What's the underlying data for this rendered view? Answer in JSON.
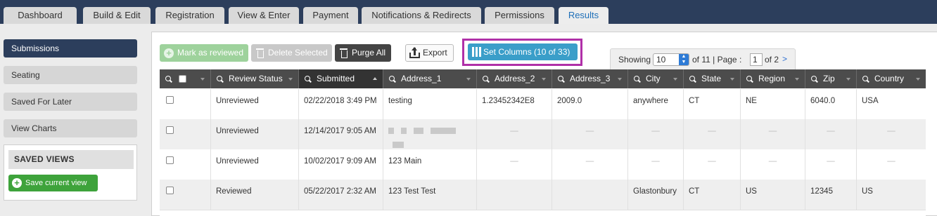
{
  "tabs": [
    {
      "label": "Dashboard"
    },
    {
      "label": "Build & Edit"
    },
    {
      "label": "Registration"
    },
    {
      "label": "View & Enter"
    },
    {
      "label": "Payment"
    },
    {
      "label": "Notifications & Redirects"
    },
    {
      "label": "Permissions"
    },
    {
      "label": "Results",
      "active": true
    }
  ],
  "sidebar": {
    "items": [
      {
        "label": "Submissions",
        "active": true
      },
      {
        "label": "Seating"
      },
      {
        "label": "Saved For Later"
      },
      {
        "label": "View Charts"
      }
    ],
    "saved_views": {
      "title": "SAVED VIEWS",
      "save_button": "Save current view"
    }
  },
  "toolbar": {
    "mark_reviewed": "Mark as reviewed",
    "delete_selected": "Delete Selected",
    "purge_all": "Purge All",
    "export": "Export",
    "set_columns": "Set Columns (10 of 33)"
  },
  "pager": {
    "showing_label": "Showing",
    "per_page": "10",
    "of_total": "of 11 | Page :",
    "page": "1",
    "of_pages": "of 2",
    "next": ">"
  },
  "table": {
    "columns": [
      "Review Status",
      "Submitted",
      "Address_1",
      "Address_2",
      "Address_3",
      "City",
      "State",
      "Region",
      "Zip",
      "Country"
    ],
    "sorted_column": "Submitted",
    "rows": [
      {
        "review_status": "Unreviewed",
        "submitted": "02/22/2018 3:49 PM",
        "address_1": "testing",
        "address_2": "1.23452342E8",
        "address_3": "2009.0",
        "city": "anywhere",
        "state": "CT",
        "region": "NE",
        "zip": "6040.0",
        "country": "USA"
      },
      {
        "review_status": "Unreviewed",
        "submitted": "12/14/2017 9:05 AM",
        "address_1": "",
        "address_2": "—",
        "address_3": "—",
        "city": "—",
        "state": "—",
        "region": "—",
        "zip": "—",
        "country": "—"
      },
      {
        "review_status": "Unreviewed",
        "submitted": "10/02/2017 9:09 AM",
        "address_1": "123 Main",
        "address_2": "—",
        "address_3": "—",
        "city": "—",
        "state": "—",
        "region": "—",
        "zip": "—",
        "country": "—"
      },
      {
        "review_status": "Reviewed",
        "submitted": "05/22/2017 2:32 AM",
        "address_1": "123 Test Test",
        "address_2": "",
        "address_3": "",
        "city": "Glastonbury",
        "state": "CT",
        "region": "US",
        "zip": "12345",
        "country": "US"
      }
    ]
  },
  "colors": {
    "header_bg": "#2c3e5c",
    "active_tab_text": "#1e6fb8",
    "highlight": "#b030a8",
    "set_columns_bg": "#3a9ec9",
    "save_green": "#3ea33b"
  }
}
